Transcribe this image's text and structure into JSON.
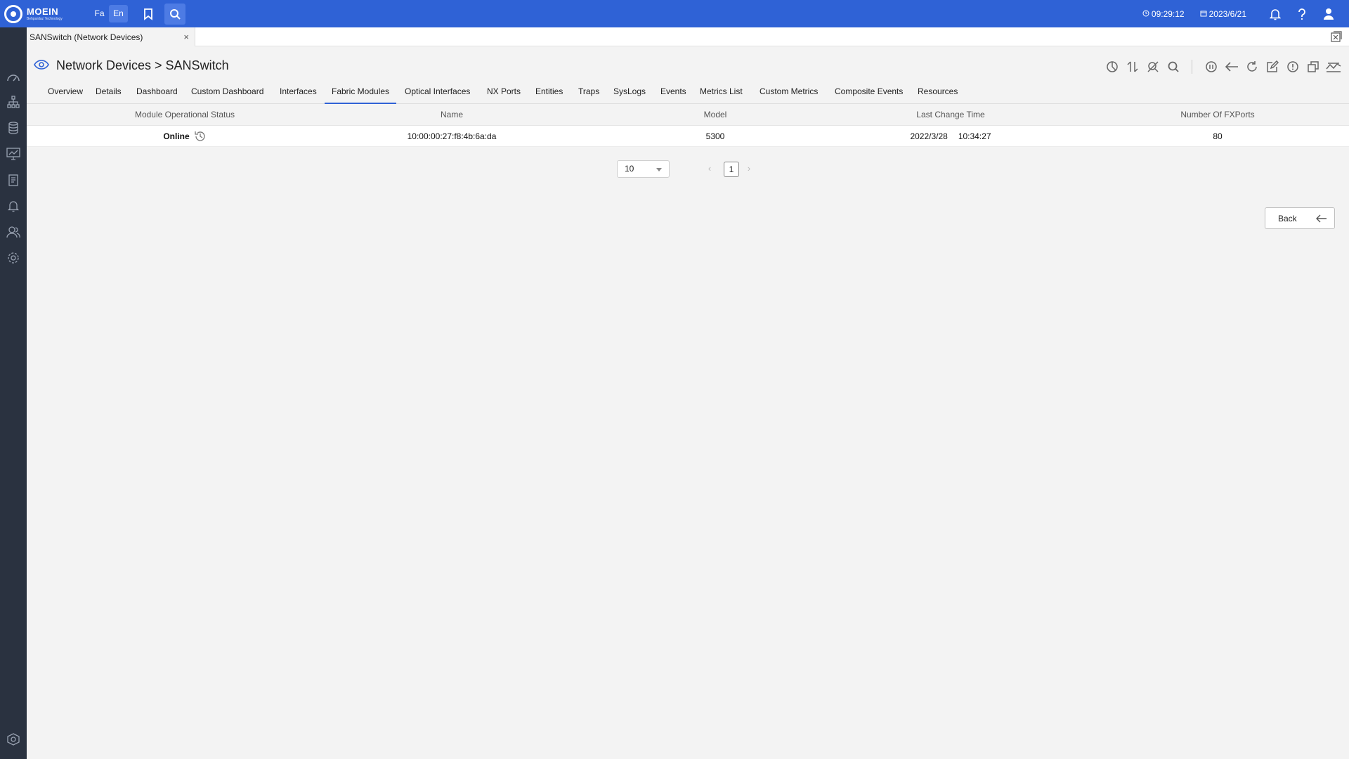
{
  "topbar": {
    "logo_text": "MOEIN",
    "logo_subtext": "Behpardaz Technology",
    "lang_fa": "Fa",
    "lang_en": "En",
    "time": "09:29:12",
    "date": "2023/6/21",
    "icons": [
      "bookmark-icon",
      "search-icon",
      "clock-icon",
      "calendar-icon",
      "bell-icon",
      "help-icon",
      "user-icon"
    ]
  },
  "sidebar": {
    "icons": [
      "speedometer-icon",
      "topology-icon",
      "database-icon",
      "monitor-icon",
      "report-icon",
      "alarm-icon",
      "users-icon",
      "settings-icon",
      "logo-footer-icon"
    ]
  },
  "doc_tab": {
    "label": "SANSwitch (Network Devices)",
    "close": "×"
  },
  "header": {
    "title": "Network Devices > SANSwitch",
    "actions": [
      "chart-icon",
      "sort-icon",
      "no-search-icon",
      "search-icon",
      "pause-icon",
      "back-arrow-icon",
      "refresh-icon",
      "edit-icon",
      "alert-icon",
      "window-icon",
      "trend-icon"
    ]
  },
  "tabs": [
    {
      "label": "Overview"
    },
    {
      "label": "Details"
    },
    {
      "label": "Dashboard"
    },
    {
      "label": "Custom Dashboard"
    },
    {
      "label": "Interfaces"
    },
    {
      "label": "Fabric Modules",
      "active": true
    },
    {
      "label": "Optical Interfaces"
    },
    {
      "label": "NX Ports"
    },
    {
      "label": "Entities"
    },
    {
      "label": "Traps"
    },
    {
      "label": "SysLogs"
    },
    {
      "label": "Events"
    },
    {
      "label": "Metrics List"
    },
    {
      "label": "Custom Metrics"
    },
    {
      "label": "Composite Events"
    },
    {
      "label": "Resources"
    }
  ],
  "table": {
    "columns": [
      "Module Operational Status",
      "Name",
      "Model",
      "Last Change Time",
      "Number Of FXPorts"
    ],
    "rows": [
      {
        "status": "Online",
        "name": "10:00:00:27:f8:4b:6a:da",
        "model": "5300",
        "last_change_date": "2022/3/28",
        "last_change_time": "10:34:27",
        "fxports": "80"
      }
    ]
  },
  "pagination": {
    "page_size": "10",
    "current_page": "1",
    "prev": "‹",
    "next": "›"
  },
  "back_button": {
    "label": "Back"
  },
  "colors": {
    "topbar": "#2f62d6",
    "sidebar": "#2a3240",
    "accent": "#2f62d6",
    "background": "#f3f3f3"
  }
}
